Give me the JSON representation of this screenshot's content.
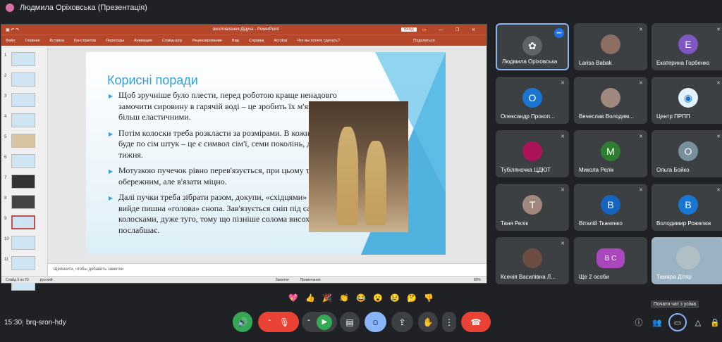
{
  "window": {
    "title": "Людмила Оріховська (Презентація)"
  },
  "powerpoint": {
    "doc_title": "виготовлення Дідуха  -  PowerPoint",
    "login_label": "Вход",
    "window_controls": "▭ — ❐ ✕",
    "ribbon_tabs": [
      "Файл",
      "Главная",
      "Вставка",
      "Конструктор",
      "Переходы",
      "Анимация",
      "Слайд-шоу",
      "Рецензирование",
      "Вид",
      "Справка",
      "Acrobat",
      "Что вы хотите сделать?",
      "Поделиться"
    ],
    "thumb_numbers": [
      "1",
      "2",
      "3",
      "4",
      "5",
      "6",
      "7",
      "8",
      "9",
      "10",
      "11",
      "12"
    ],
    "slide_title": "Корисні поради",
    "bullets": [
      "Щоб зручніше було плести, перед роботою краще ненадовго замочити сировину в гарячій воді – це зробить їх м'якшими та більш еластичними.",
      "Потім колоски треба розкласти за розмірами. В кожному пучку буде по сім штук – це є символ сім'ї, семи поколінь, днів тижня.",
      "Мотузкою пучечок рівно перев'язується, при цьому треба бути обережним, але в'язати міцно.",
      "Далі пучки треба зібрати разом, докупи, «східцями» - так вийде пишна «голова» снопа. Зав'язується сніп під самими колосками, дуже туго, тому що пізніше солома висохне і вузол послабшає."
    ],
    "notes_placeholder": "Щелкните, чтобы добавить заметки",
    "status_left": "Слайд 9 из 20",
    "status_lang": "русский",
    "status_notes": "Заметки",
    "status_comments": "Примечания",
    "status_zoom": "80%"
  },
  "participants": [
    {
      "name": "Людмила Оріховська",
      "initial": "",
      "color": "#5f6368"
    },
    {
      "name": "Larisa Babak",
      "initial": "",
      "color": "#8d6e63"
    },
    {
      "name": "Екатерина Горбенко",
      "initial": "Е",
      "color": "#7e57c2"
    },
    {
      "name": "Олександр Прокоп...",
      "initial": "О",
      "color": "#1976d2"
    },
    {
      "name": "Вячеслав Володим...",
      "initial": "",
      "color": "#a1887f"
    },
    {
      "name": "Центр ПРПП",
      "initial": "",
      "color": "#e3f2fd"
    },
    {
      "name": "Тубіляночка ЦДЮТ",
      "initial": "",
      "color": "#ad1457"
    },
    {
      "name": "Микола Релік",
      "initial": "M",
      "color": "#2e7d32"
    },
    {
      "name": "Ольга Бойко",
      "initial": "O",
      "color": "#78909c"
    },
    {
      "name": "Таня Релік",
      "initial": "T",
      "color": "#a1887f"
    },
    {
      "name": "Віталій Ткаченко",
      "initial": "B",
      "color": "#1565c0"
    },
    {
      "name": "Володимир Рожелюк",
      "initial": "B",
      "color": "#1976d2"
    },
    {
      "name": "Ксенія Василівна Л...",
      "initial": "",
      "color": "#6d4c41"
    },
    {
      "name": "Ще 2 особи",
      "initial": "B C",
      "color": "#ab47bc"
    },
    {
      "name": "Тамара Дітяр",
      "initial": "",
      "color": "#b0bec5"
    }
  ],
  "reactions": [
    "💖",
    "👍",
    "🎉",
    "👏",
    "😂",
    "😮",
    "😢",
    "🤔",
    "👎"
  ],
  "bottom": {
    "time": "15:30",
    "separator": "|",
    "meeting_code": "brq-sron-hdy",
    "tooltip": "Почати чат з усіма"
  },
  "colors": {
    "mic_green": "#34a853",
    "end_red": "#ea4335",
    "selected_blue": "#8ab4f8"
  }
}
